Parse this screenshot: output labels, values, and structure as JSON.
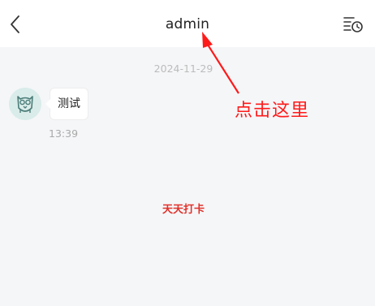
{
  "header": {
    "title": "admin",
    "back_icon": "chevron-left-icon",
    "history_icon": "history-list-icon"
  },
  "chat": {
    "date_separator": "2024-11-29",
    "messages": [
      {
        "text": "测试",
        "time": "13:39",
        "sender_avatar": "owl-avatar"
      }
    ]
  },
  "daily_checkin_label": "天天打卡",
  "annotation": {
    "text": "点击这里",
    "color": "#ff1a1a"
  },
  "colors": {
    "background": "#f5f6f8",
    "header_bg": "#ffffff",
    "accent_red": "#e0322b"
  }
}
